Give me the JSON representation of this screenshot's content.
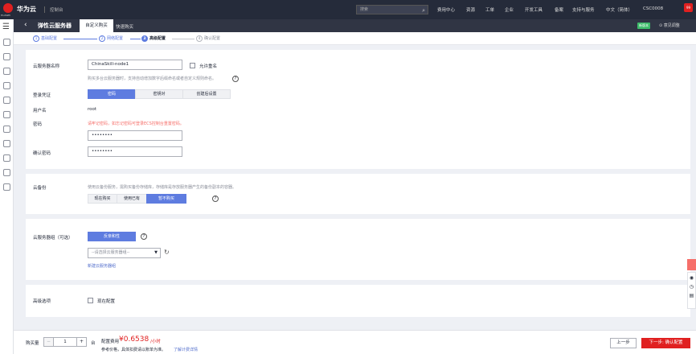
{
  "topbar": {
    "brand": "华为云",
    "logo_caption": "HUAWEI",
    "console": "控制台",
    "search_placeholder": "搜索",
    "nav": [
      "费用中心",
      "资源",
      "工单",
      "企业",
      "开发工具",
      "备案",
      "支持与服务",
      "中文（简体）",
      "CSC0008"
    ],
    "notification_count": "99"
  },
  "header": {
    "title": "弹性云服务器",
    "tab_custom": "自定义购买",
    "tab_quick": "快速购买",
    "new_badge": "新版本",
    "feedback": "意见调整"
  },
  "steps": [
    {
      "num": "1",
      "label": "基础配置"
    },
    {
      "num": "2",
      "label": "网络配置"
    },
    {
      "num": "3",
      "label": "高级配置"
    },
    {
      "num": "4",
      "label": "确认配置"
    }
  ],
  "form": {
    "name_label": "云服务器名称",
    "name_value": "ChinaSkill-node1",
    "allow_dup_label": "允许重名",
    "name_hint": "购买多台云服务器时，支持自动增加数字后缀命名或者自定义规则命名。",
    "login_label": "登录凭证",
    "login_options": [
      "密码",
      "密钥对",
      "创建后设置"
    ],
    "user_label": "用户名",
    "user_value": "root",
    "password_label": "密码",
    "password_warning": "请牢记密码，如忘记密码可登录ECS控制台重置密码。",
    "password_value": "••••••••",
    "confirm_label": "确认密码",
    "confirm_value": "••••••••"
  },
  "backup": {
    "label": "云备份",
    "hint": "使用云备份服务，需购买备份存储库，存储库是存放服务器产生的备份副本的容器。",
    "options": [
      "现在购买",
      "使用已有",
      "暂不购买"
    ]
  },
  "group": {
    "label": "云服务器组（可选）",
    "anti_affinity": "反亲和性",
    "select_placeholder": "--请选择云服务器组--",
    "new_link": "新建云服务器组"
  },
  "advanced": {
    "label": "高级选项",
    "checkbox": "现在配置"
  },
  "footer": {
    "qty_label": "购买量",
    "qty_value": "1",
    "unit": "台",
    "fee_label": "配置费用",
    "price": "¥0.6538",
    "price_unit": "/小时",
    "fee_note": "参考价格，具体扣费请以账单为准。",
    "billing_link": "了解计费详情",
    "prev_button": "上一步",
    "next_button": "下一步: 确认配置"
  }
}
